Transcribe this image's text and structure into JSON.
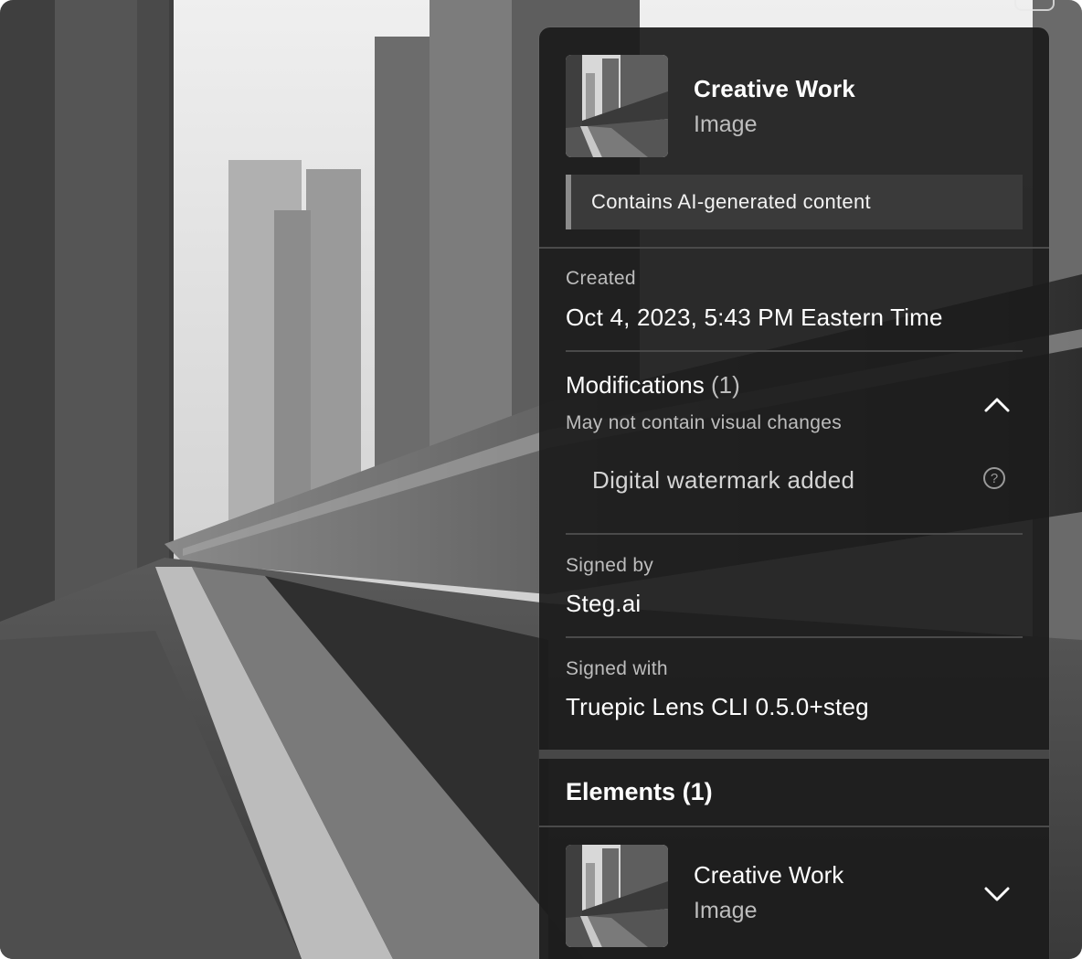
{
  "asset": {
    "title": "Creative Work",
    "type": "Image",
    "ai_notice": "Contains AI-generated content"
  },
  "created": {
    "label": "Created",
    "value": "Oct 4, 2023, 5:43 PM Eastern Time"
  },
  "modifications": {
    "title": "Modifications",
    "count": "(1)",
    "subtitle": "May not contain visual changes",
    "items": [
      {
        "label": "Digital watermark added",
        "help_icon": "question-circle-icon"
      }
    ],
    "expanded": true,
    "toggle_icon": "chevron-up-icon"
  },
  "signed_by": {
    "label": "Signed by",
    "value": "Steg.ai"
  },
  "signed_with": {
    "label": "Signed with",
    "value": "Truepic Lens CLI 0.5.0+steg"
  },
  "elements": {
    "title": "Elements",
    "count": "(1)",
    "items": [
      {
        "title": "Creative Work",
        "type": "Image",
        "toggle_icon": "chevron-down-icon"
      }
    ]
  },
  "colors": {
    "panel_bg": "#1c1c1c",
    "banner_bg": "#3a3a3a",
    "banner_accent": "#8b8b8b",
    "text_primary": "#ffffff",
    "text_secondary": "#bdbdbd"
  }
}
